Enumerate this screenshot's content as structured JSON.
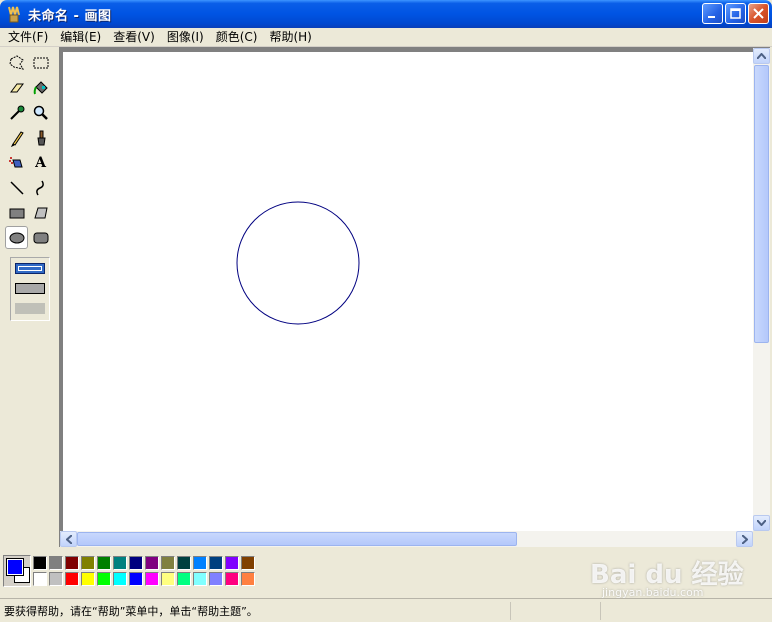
{
  "window": {
    "title": "未命名 - 画图"
  },
  "menu": [
    {
      "label": "文件(F)"
    },
    {
      "label": "编辑(E)"
    },
    {
      "label": "查看(V)"
    },
    {
      "label": "图像(I)"
    },
    {
      "label": "颜色(C)"
    },
    {
      "label": "帮助(H)"
    }
  ],
  "tools": [
    {
      "name": "free-form-select-icon"
    },
    {
      "name": "rect-select-icon"
    },
    {
      "name": "eraser-icon"
    },
    {
      "name": "fill-bucket-icon"
    },
    {
      "name": "color-picker-icon"
    },
    {
      "name": "magnifier-icon"
    },
    {
      "name": "pencil-icon"
    },
    {
      "name": "brush-icon"
    },
    {
      "name": "airbrush-icon"
    },
    {
      "name": "text-icon",
      "glyph": "A"
    },
    {
      "name": "line-icon"
    },
    {
      "name": "curve-icon"
    },
    {
      "name": "rectangle-icon"
    },
    {
      "name": "polygon-icon"
    },
    {
      "name": "ellipse-icon",
      "selected": true
    },
    {
      "name": "rounded-rect-icon"
    }
  ],
  "current_colors": {
    "foreground": "#0000ff",
    "background": "#ffffff"
  },
  "palette_top": [
    "#000000",
    "#808080",
    "#800000",
    "#808000",
    "#008000",
    "#008080",
    "#000080",
    "#800080",
    "#808040",
    "#004040",
    "#0080ff",
    "#004080",
    "#8000ff",
    "#804000"
  ],
  "palette_bottom": [
    "#ffffff",
    "#c0c0c0",
    "#ff0000",
    "#ffff00",
    "#00ff00",
    "#00ffff",
    "#0000ff",
    "#ff00ff",
    "#ffff80",
    "#00ff80",
    "#80ffff",
    "#8080ff",
    "#ff0080",
    "#ff8040"
  ],
  "status": {
    "text": "要获得帮助，请在“帮助”菜单中，单击“帮助主题”。"
  },
  "watermark": {
    "logo": "Bai du 经验",
    "sub": "jingyan.baidu.com"
  }
}
